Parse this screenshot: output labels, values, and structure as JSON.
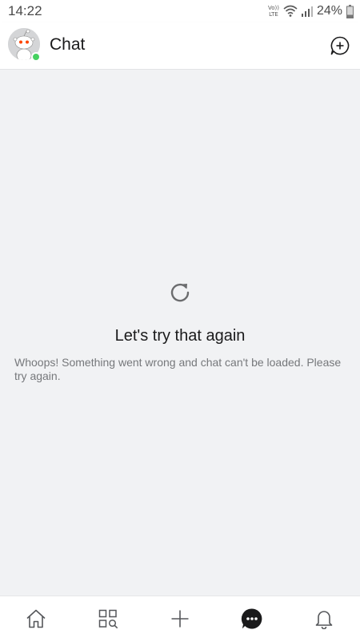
{
  "status_bar": {
    "time": "14:22",
    "volte_top": "Vo))",
    "volte_bottom": "LTE",
    "battery": "24%"
  },
  "header": {
    "title": "Chat"
  },
  "error": {
    "title": "Let's try that again",
    "message": "Whoops! Something went wrong and chat can't be loaded. Please try again."
  },
  "icons": {
    "avatar": "reddit-snoo-avatar",
    "new_chat": "new-chat-icon",
    "retry": "refresh-icon",
    "nav": [
      "home-icon",
      "discover-icon",
      "create-icon",
      "chat-icon",
      "bell-icon"
    ]
  },
  "colors": {
    "online": "#46d160",
    "background": "#f1f2f4",
    "text_primary": "#1a1a1b",
    "text_secondary": "#76787b"
  }
}
